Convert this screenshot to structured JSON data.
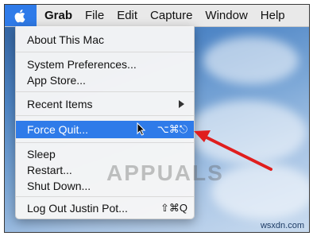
{
  "menubar": {
    "apple_icon": "apple-logo-icon",
    "items": [
      "Grab",
      "File",
      "Edit",
      "Capture",
      "Window",
      "Help"
    ]
  },
  "apple_menu": {
    "about": "About This Mac",
    "system_preferences": "System Preferences...",
    "app_store": "App Store...",
    "recent_items": "Recent Items",
    "force_quit": "Force Quit...",
    "force_quit_shortcut": "⌥⌘⎋",
    "sleep": "Sleep",
    "restart": "Restart...",
    "shut_down": "Shut Down...",
    "log_out": "Log Out Justin Pot...",
    "log_out_shortcut": "⇧⌘Q"
  },
  "watermark": {
    "brand": "APPUALS",
    "site": "wsxdn.com"
  },
  "colors": {
    "highlight": "#2f7be9",
    "annotation_arrow": "#e01e1e"
  }
}
